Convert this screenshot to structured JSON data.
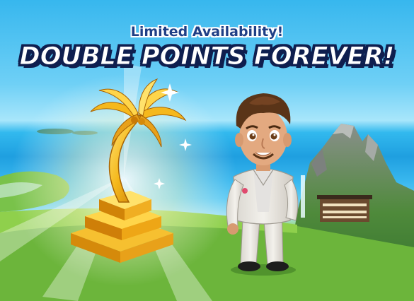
{
  "header": {
    "subtitle": "Limited Availability!",
    "title": "DOUBLE POINTS FOREVER!"
  },
  "colors": {
    "sky": "#37b7ee",
    "ocean": "#1f9fe0",
    "grass": "#6cb53b",
    "gold": "#f5b81c",
    "title_outline": "#0f1f4f",
    "subtitle_text": "#1f3f86"
  },
  "scene": {
    "trophy_icon": "golden-palm-tree-trophy",
    "avatar": "man-in-white-suit",
    "landscape": "tropical-island-with-mountains"
  }
}
